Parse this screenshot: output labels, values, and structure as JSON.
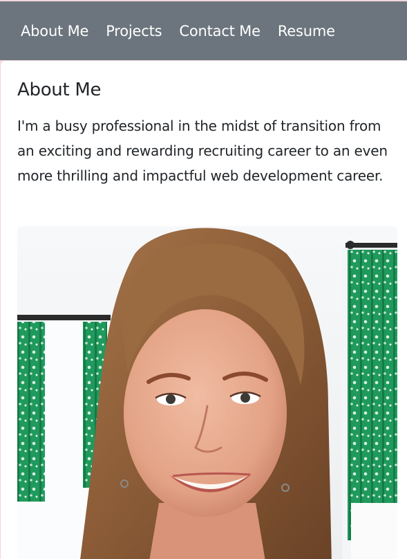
{
  "nav": {
    "items": [
      {
        "label": "About Me"
      },
      {
        "label": "Projects"
      },
      {
        "label": "Contact Me"
      },
      {
        "label": "Resume"
      }
    ]
  },
  "about": {
    "title": "About Me",
    "bio": "I'm a busy professional in the midst of transition from an exciting and rewarding recruiting career to an even more thrilling and impactful web development career."
  },
  "colors": {
    "navbar": "#6c757d",
    "nav_text": "#ffffff",
    "text": "#212529",
    "page_background": "#f3d6dc"
  }
}
